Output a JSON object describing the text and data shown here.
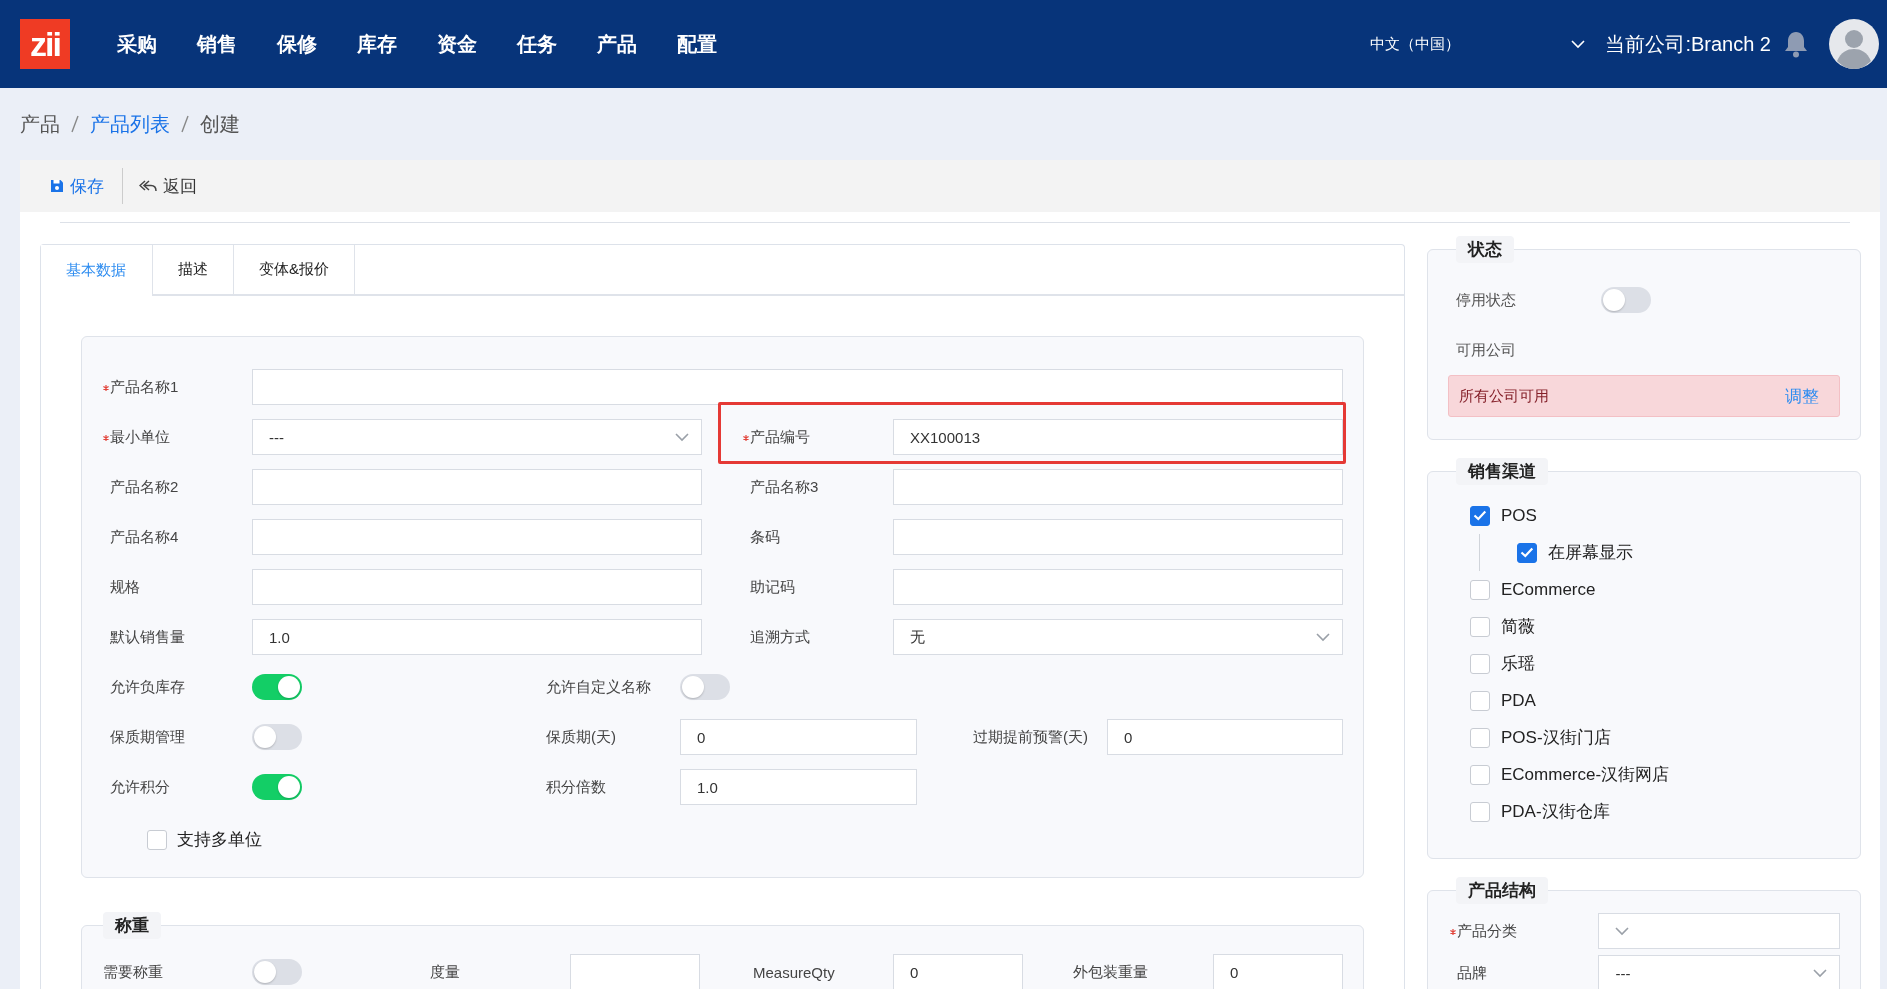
{
  "header": {
    "logo": "zii",
    "nav": [
      "采购",
      "销售",
      "保修",
      "库存",
      "资金",
      "任务",
      "产品",
      "配置"
    ],
    "language": "中文（中国）",
    "company": "当前公司:Branch 2"
  },
  "breadcrumb": [
    {
      "label": "产品",
      "link": false
    },
    {
      "label": "产品列表",
      "link": true
    },
    {
      "label": "创建",
      "link": false
    }
  ],
  "toolbar": [
    {
      "kind": "save",
      "label": "保存"
    },
    {
      "kind": "back",
      "label": "返回"
    }
  ],
  "tabs": [
    {
      "label": "基本数据",
      "selected": true
    },
    {
      "label": "描述",
      "selected": false
    },
    {
      "label": "变体&报价",
      "selected": false
    }
  ],
  "basic": {
    "rows": [
      {
        "kind": "wide",
        "cells": [
          {
            "label": "产品名称1",
            "required": true,
            "kind": "input"
          }
        ]
      },
      {
        "kind": "pair",
        "cells": [
          {
            "label": "最小单位",
            "required": true,
            "kind": "select",
            "value": "---"
          },
          {
            "label": "产品编号",
            "required": true,
            "kind": "input",
            "value": "XX100013",
            "highlighted": true
          }
        ]
      },
      {
        "kind": "pair",
        "cells": [
          {
            "label": "产品名称2",
            "required": false,
            "kind": "input"
          },
          {
            "label": "产品名称3",
            "required": false,
            "kind": "input"
          }
        ]
      },
      {
        "kind": "pair",
        "cells": [
          {
            "label": "产品名称4",
            "required": false,
            "kind": "input"
          },
          {
            "label": "条码",
            "required": false,
            "kind": "input"
          }
        ]
      },
      {
        "kind": "pair",
        "cells": [
          {
            "label": "规格",
            "required": false,
            "kind": "input"
          },
          {
            "label": "助记码",
            "required": false,
            "kind": "input"
          }
        ]
      },
      {
        "kind": "pair",
        "cells": [
          {
            "label": "默认销售量",
            "required": false,
            "kind": "input",
            "value": "1.0"
          },
          {
            "label": "追溯方式",
            "required": false,
            "kind": "select",
            "value": "无"
          }
        ]
      },
      {
        "kind": "triple",
        "cells": [
          {
            "label": "允许负库存",
            "required": false,
            "kind": "toggle",
            "on": true
          },
          {
            "label": "允许自定义名称",
            "required": false,
            "kind": "toggle",
            "on": false
          }
        ]
      },
      {
        "kind": "triple",
        "cells": [
          {
            "label": "保质期管理",
            "required": false,
            "kind": "toggle",
            "on": false
          },
          {
            "label": "保质期(天)",
            "required": false,
            "kind": "input",
            "value": "0"
          },
          {
            "label": "过期提前预警(天)",
            "required": false,
            "kind": "input",
            "value": "0"
          }
        ]
      },
      {
        "kind": "triple",
        "cells": [
          {
            "label": "允许积分",
            "required": false,
            "kind": "toggle",
            "on": true
          },
          {
            "label": "积分倍数",
            "required": false,
            "kind": "input",
            "value": "1.0"
          }
        ]
      }
    ],
    "multi_unit": {
      "label": "支持多单位",
      "checked": false
    }
  },
  "weighing": {
    "title": "称重",
    "cells": [
      {
        "label": "需要称重",
        "kind": "toggle",
        "on": false
      },
      {
        "label": "度量",
        "kind": "input"
      },
      {
        "label": "MeasureQty",
        "kind": "input",
        "value": "0"
      },
      {
        "label": "外包装重量",
        "kind": "input",
        "value": "0"
      }
    ]
  },
  "status": {
    "title": "状态",
    "disabled_label": "停用状态",
    "disabled": false,
    "companies_label": "可用公司",
    "companies_value": "所有公司可用",
    "adjust": "调整"
  },
  "sales_channels": {
    "title": "销售渠道",
    "items": [
      {
        "label": "POS",
        "checked": true,
        "children": [
          {
            "label": "在屏幕显示",
            "checked": true
          }
        ]
      },
      {
        "label": "ECommerce",
        "checked": false
      },
      {
        "label": "简薇",
        "checked": false
      },
      {
        "label": "乐瑶",
        "checked": false
      },
      {
        "label": "PDA",
        "checked": false
      },
      {
        "label": "POS-汉街门店",
        "checked": false
      },
      {
        "label": "ECommerce-汉街网店",
        "checked": false
      },
      {
        "label": "PDA-汉街仓库",
        "checked": false
      }
    ]
  },
  "structure": {
    "title": "产品结构",
    "fields": [
      {
        "label": "产品分类",
        "required": true
      },
      {
        "label": "品牌",
        "required": false,
        "value": "---"
      }
    ]
  }
}
